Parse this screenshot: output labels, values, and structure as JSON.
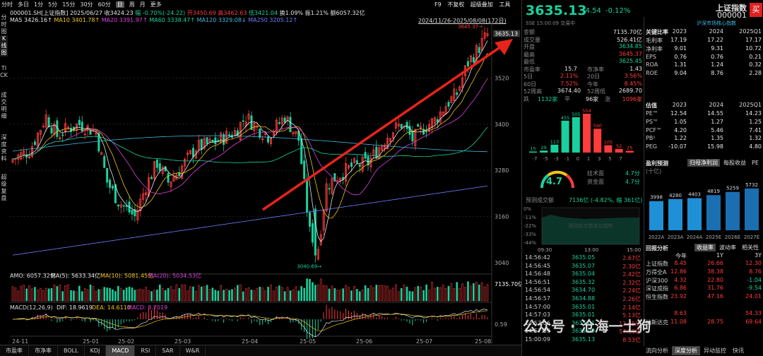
{
  "topbar": {
    "items": [
      "分时",
      "多日",
      "1分",
      "5分",
      "15分",
      "30分",
      "60分",
      "日",
      "周",
      "月",
      "更多"
    ],
    "active_index": 7
  },
  "info1": {
    "code": "000001.SH[上证指数]",
    "date": "2025/06/27",
    "close": "收3424.23",
    "change": "幅 -0.70%(-24.22)",
    "high": "高3462.63",
    "open": "开3450.69",
    "low": "低3421.04",
    "turnover": "换1.09%",
    "amplitude": "振1.21%",
    "amount": "额6057.32亿"
  },
  "ma": {
    "ma5": "MA5 3426.16↑",
    "ma10": "MA10 3401.78↑",
    "ma20": "MA20 3391.97↑",
    "ma60": "MA60 3338.47↑",
    "ma120": "MA120 3329.08↓",
    "ma250": "MA250 3205.12↑"
  },
  "range": "2024/11/26-2025/08/08(172日)",
  "sidebar": [
    "分时图",
    "K线图",
    "TICK",
    "成交明细",
    "深度资料",
    "超级复盘"
  ],
  "price_axis": {
    "labels": [
      "3635.13",
      "3520",
      "3400",
      "3280",
      "3160",
      "3040"
    ],
    "max_label": "3645.37→",
    "min_label": "3040.69→"
  },
  "dates": [
    "24-11",
    "25-01",
    "25-02",
    "25-03",
    "25-04",
    "25-05",
    "25-06",
    "25-07",
    "25-08"
  ],
  "amo": {
    "label": "AMO: 6057.32亿",
    "ma5": "MA(5): 5633.34亿",
    "ma10": "MA(10): 5081.45亿",
    "ma20": "MA(20): 5034.53亿",
    "axis": "7135.70亿"
  },
  "macd": {
    "label": "MACD(12,26,9)",
    "dif": "DIF: 18.9619",
    "dea": "DEA: 14.6110",
    "macd": "MACD: 8.7019",
    "axis": "0.59"
  },
  "bottom_tabs": [
    "市盈率",
    "市净率",
    "BOLL",
    "KDJ",
    "MACD",
    "RSI",
    "SAR",
    "W&R"
  ],
  "bottom_active": 4,
  "toolbar": {
    "f9": "F9",
    "tags": [
      "不复权",
      "超级叠加",
      "工具"
    ]
  },
  "right": {
    "price": "3635.13",
    "change": "-4.54",
    "pct": "-0.12%",
    "name": "上证指数",
    "code": "000001",
    "buy": "买",
    "status": "SSE 15:00:09 交易中",
    "amount_label": "金额",
    "amount": "7135.70亿",
    "volume_label": "成交量",
    "volume": "526.41亿",
    "open_label": "开盘",
    "open": "3634.85",
    "high_label": "最高",
    "high": "3645.37",
    "low_label": "最低",
    "low": "3625.45",
    "pe_label": "市盈率",
    "pe": "15.7",
    "pb_label": "市净率",
    "pb": "1.43",
    "d5_label": "5日",
    "d5": "2.11%",
    "d20_label": "20日",
    "d20": "3.56%",
    "d60_label": "60日",
    "d60": "7.52%",
    "ytd_label": "今年",
    "ytd": "8.45%",
    "w52h_label": "52周高",
    "w52h": "3674.40",
    "w52l_label": "52周低",
    "w52l": "2689.70",
    "fall_label": "跌",
    "fall": "1132家",
    "flat_label": "平",
    "flat": "96家",
    "rise_label": "涨",
    "rise": "1096家",
    "dist_labels": [
      "-7",
      "-5",
      "-3",
      "-1",
      "0",
      "1",
      "3",
      "5",
      "7"
    ],
    "dist_values": [
      "15",
      "29",
      "113",
      "455",
      "505",
      "554",
      "340",
      "105",
      "52",
      "25"
    ],
    "score": "4.7",
    "tech_label": "技术面",
    "tech": "4.7分",
    "fund_label": "资金面",
    "fund": "4.7分",
    "forecast_label": "预测成交额",
    "forecast": "7136亿 (-4.82%, 缩 361亿)",
    "intraday_y": [
      "0%",
      "-11%",
      "-22%",
      "-33%",
      "-44%"
    ],
    "intraday_x": [
      "09:30",
      "13:00",
      "15:00"
    ],
    "intraday_note": "预测成交额变化趋势",
    "trades": [
      {
        "t": "14:56:42",
        "p": "3635.05",
        "a": "2.67亿"
      },
      {
        "t": "14:56:45",
        "p": "3635.07",
        "a": "2.30亿"
      },
      {
        "t": "14:56:48",
        "p": "3635.04",
        "a": "2.42亿"
      },
      {
        "t": "14:56:51",
        "p": "3635.32",
        "a": "2.32亿"
      },
      {
        "t": "14:56:54",
        "p": "3634.70",
        "a": "2.24亿"
      },
      {
        "t": "14:56:57",
        "p": "3634.88",
        "a": "2.26亿"
      },
      {
        "t": "14:57:00",
        "p": "3635.01",
        "a": "2.14亿"
      },
      {
        "t": "14:57:03",
        "p": "3635.01",
        "a": "5.13亿"
      },
      {
        "t": "14:57:06",
        "p": "3635.01",
        "a": "12.45亿"
      },
      {
        "t": "14:57:09",
        "p": "3635.09",
        "a": "57.59亿"
      },
      {
        "t": "15:00:09",
        "p": "3635.13",
        "a": "8.53亿"
      }
    ],
    "key_title": "关键比率",
    "key_cols": [
      "2023",
      "2024",
      "2025Q1"
    ],
    "key_rows": [
      [
        "毛利率",
        "17.19",
        "17.22",
        "17.17"
      ],
      [
        "净利率",
        "9.01",
        "9.31",
        "10.72"
      ],
      [
        "EPS",
        "0.76",
        "0.76",
        "0.21"
      ],
      [
        "ROA",
        "1.31",
        "1.24",
        "0.32"
      ],
      [
        "ROE",
        "9.04",
        "8.76",
        "2.28"
      ]
    ],
    "val_title": "估值",
    "val_cols": [
      "2023",
      "2024",
      "2025Q1"
    ],
    "val_rows": [
      [
        "PE™",
        "12.54",
        "14.55",
        "14.23"
      ],
      [
        "PS™",
        "1.05",
        "1.27",
        "1.25"
      ],
      [
        "PCF™",
        "4.20",
        "5.46",
        "7.41"
      ],
      [
        "PB¹",
        "1.22",
        "1.35",
        "1.32"
      ],
      [
        "PEG",
        "-10.07",
        "15.98",
        "4.80"
      ]
    ],
    "profit_title": "盈利预测",
    "profit_unit": "(十亿)",
    "profit_tabs": [
      "归母净利润",
      "每股收益",
      "PE"
    ],
    "profit_years": [
      "2022A",
      "2023A",
      "2024A",
      "2025E",
      "2026E",
      "2027E"
    ],
    "profit_values": [
      3998,
      4280,
      4403,
      4819,
      5259,
      5732
    ],
    "ret_title": "回报分析",
    "ret_tabs": [
      "收益率",
      "波动率",
      "相关性"
    ],
    "ret_cols": [
      "今年",
      "1Y",
      "3Y"
    ],
    "ret_rows": [
      [
        "上证指数",
        "8.45",
        "26.66",
        "12.30"
      ],
      [
        "万得全A",
        "12.86",
        "38.38",
        "8.76"
      ],
      [
        "沪深300",
        "4.32",
        "22.80",
        "-1.04"
      ],
      [
        "深证成指",
        "6.86",
        "31.76",
        "-9.54"
      ],
      [
        "恒生指数",
        "23.92",
        "47.16",
        "24.01"
      ],
      [
        "",
        "",
        "",
        ""
      ],
      [
        "",
        "8.63",
        "",
        "54.33"
      ],
      [
        "纳斯达克",
        "11.08",
        "28.75",
        "69.64"
      ]
    ],
    "right_bottom_tabs": [
      "流向分析",
      "深度分析",
      "异动监控",
      "快讯"
    ],
    "right_bottom_active": 1,
    "sse_link": "沪深市场核心指数"
  },
  "watermark": "公众号 · 沧海一土狗"
}
